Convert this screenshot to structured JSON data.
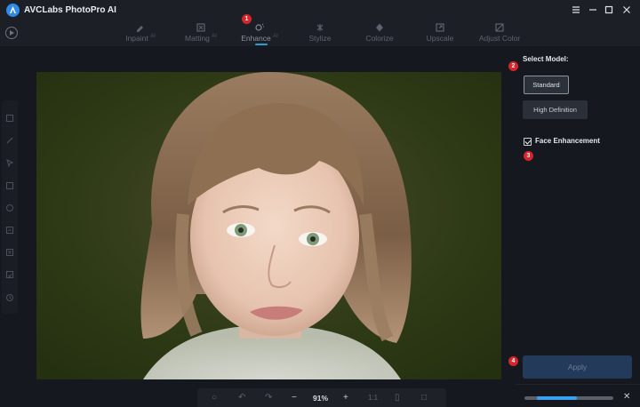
{
  "app": {
    "title": "AVCLabs PhotoPro AI"
  },
  "window_controls": [
    {
      "name": "menu-icon"
    },
    {
      "name": "minimize-icon"
    },
    {
      "name": "maximize-icon"
    },
    {
      "name": "close-icon"
    }
  ],
  "tabs": [
    {
      "label": "Inpaint",
      "ai": "AI",
      "icon": "inpaint-icon",
      "active": false
    },
    {
      "label": "Matting",
      "ai": "AI",
      "icon": "matting-icon",
      "active": false
    },
    {
      "label": "Enhance",
      "ai": "AI",
      "icon": "enhance-icon",
      "active": true
    },
    {
      "label": "Stylize",
      "ai": "",
      "icon": "stylize-icon",
      "active": false
    },
    {
      "label": "Colorize",
      "ai": "",
      "icon": "colorize-icon",
      "active": false
    },
    {
      "label": "Upscale",
      "ai": "",
      "icon": "upscale-icon",
      "active": false
    },
    {
      "label": "Adjust Color",
      "ai": "",
      "icon": "adjust-color-icon",
      "active": false
    }
  ],
  "badges": {
    "b1": "1",
    "b2": "2",
    "b3": "3",
    "b4": "4"
  },
  "left_tools": [
    "layers-icon",
    "brush-icon",
    "pointer-icon",
    "rectangle-icon",
    "circle-icon",
    "crop-icon",
    "text-icon",
    "save-icon",
    "history-icon"
  ],
  "bottom_toolbar": {
    "zoom": "91%",
    "fit": "1:1",
    "minus": "−",
    "plus": "+"
  },
  "right_panel": {
    "select_model_label": "Select Model:",
    "models": {
      "standard": "Standard",
      "high_definition": "High Definition"
    },
    "selected_model": "Standard",
    "face_enhancement": {
      "label": "Face Enhancement",
      "checked": true
    },
    "apply_label": "Apply",
    "progress": 0.45,
    "close_symbol": "✕"
  },
  "colors": {
    "accent": "#2e9bd3",
    "badge": "#d8232a",
    "apply_bg": "#233a5b",
    "background": "#15181e"
  }
}
